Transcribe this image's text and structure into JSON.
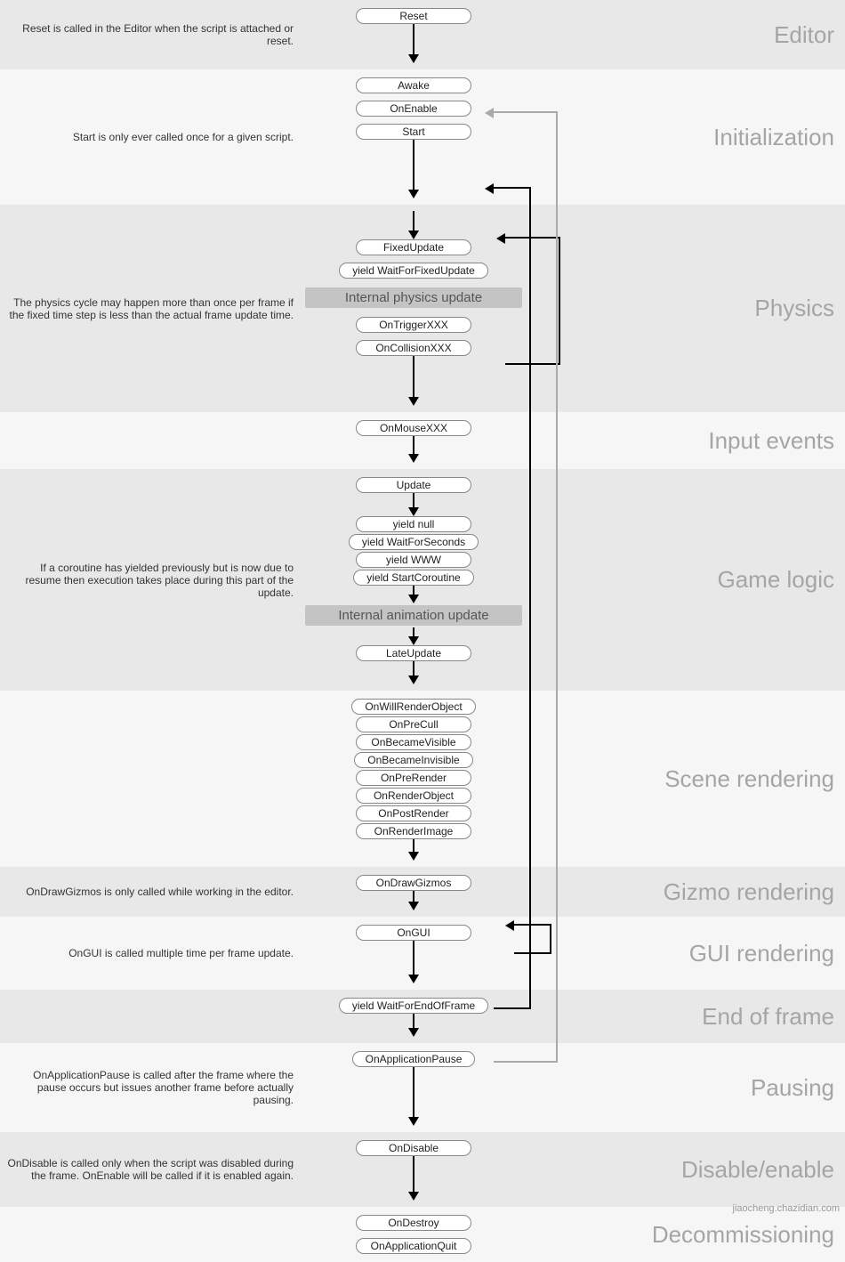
{
  "watermark": "jiaocheng.chazidian.com",
  "sections": {
    "editor": {
      "title": "Editor",
      "note": "Reset is called in the Editor when the script is attached or reset.",
      "nodes": [
        "Reset"
      ]
    },
    "initialization": {
      "title": "Initialization",
      "note": "Start is only ever called once for a given script.",
      "nodes": [
        "Awake",
        "OnEnable",
        "Start"
      ]
    },
    "physics": {
      "title": "Physics",
      "note": "The physics cycle may happen more than once per frame if the fixed time step is less than the actual frame update time.",
      "nodes_top": [
        "FixedUpdate",
        "yield WaitForFixedUpdate"
      ],
      "internal": "Internal physics update",
      "nodes_bottom": [
        "OnTriggerXXX",
        "OnCollisionXXX"
      ]
    },
    "input": {
      "title": "Input events",
      "nodes": [
        "OnMouseXXX"
      ]
    },
    "gamelogic": {
      "title": "Game logic",
      "note": "If a coroutine has yielded previously but is now due to resume then execution takes place during this part of the update.",
      "nodes_top": [
        "Update"
      ],
      "yields": [
        "yield null",
        "yield WaitForSeconds",
        "yield WWW",
        "yield StartCoroutine"
      ],
      "internal": "Internal animation update",
      "nodes_bottom": [
        "LateUpdate"
      ]
    },
    "scene": {
      "title": "Scene rendering",
      "nodes": [
        "OnWillRenderObject",
        "OnPreCull",
        "OnBecameVisible",
        "OnBecameInvisible",
        "OnPreRender",
        "OnRenderObject",
        "OnPostRender",
        "OnRenderImage"
      ]
    },
    "gizmo": {
      "title": "Gizmo rendering",
      "note": "OnDrawGizmos is only called while working in the editor.",
      "nodes": [
        "OnDrawGizmos"
      ]
    },
    "gui": {
      "title": "GUI rendering",
      "note": "OnGUI is called multiple time per frame update.",
      "nodes": [
        "OnGUI"
      ]
    },
    "endframe": {
      "title": "End of frame",
      "nodes": [
        "yield WaitForEndOfFrame"
      ]
    },
    "pausing": {
      "title": "Pausing",
      "note": "OnApplicationPause is called after the frame where the pause occurs but issues another frame before actually pausing.",
      "nodes": [
        "OnApplicationPause"
      ]
    },
    "disable": {
      "title": "Disable/enable",
      "note": "OnDisable is called only when the script was disabled during the frame. OnEnable will be called if it is enabled again.",
      "nodes": [
        "OnDisable"
      ]
    },
    "decomm": {
      "title": "Decommissioning",
      "nodes": [
        "OnDestroy",
        "OnApplicationQuit"
      ]
    }
  },
  "loops": [
    {
      "desc": "physics-self-loop",
      "from": "OnCollisionXXX",
      "to": "FixedUpdate"
    },
    {
      "desc": "gui-self-loop",
      "from": "OnGUI",
      "to": "OnGUI"
    },
    {
      "desc": "frame-loop",
      "from": "OnApplicationPause",
      "to": "FixedUpdate(top)"
    },
    {
      "desc": "enable-loop-grey",
      "from": "OnDisable",
      "to": "OnEnable"
    }
  ]
}
